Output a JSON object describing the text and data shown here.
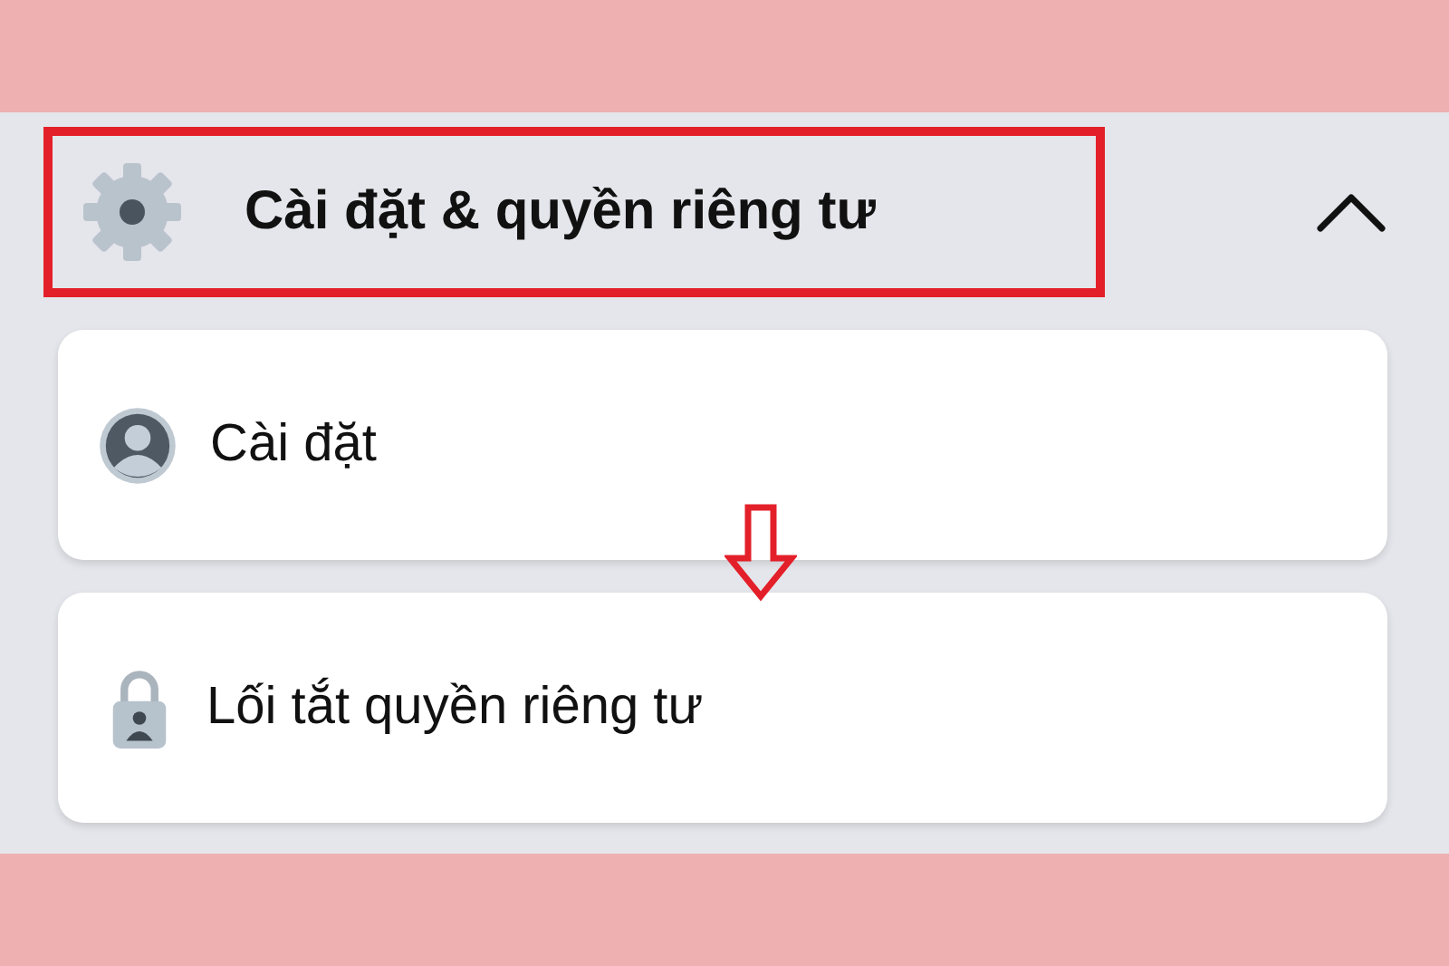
{
  "section": {
    "title": "Cài đặt & quyền riêng tư",
    "expanded": true,
    "highlighted": true,
    "items": [
      {
        "kind": "profile",
        "label": "Cài đặt"
      },
      {
        "kind": "lock",
        "label": "Lối tắt quyền riêng tư"
      }
    ]
  }
}
